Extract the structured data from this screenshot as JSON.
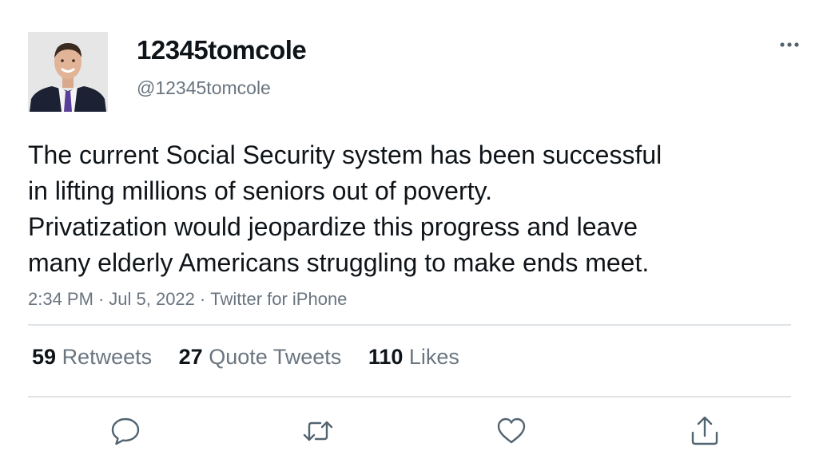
{
  "user": {
    "display_name": "12345tomcole",
    "handle": "@12345tomcole",
    "avatar_icon": "profile-photo"
  },
  "tweet": {
    "text_lines": [
      "The current Social Security system has been successful",
      "in lifting millions of seniors out of poverty.",
      "Privatization would jeopardize this progress and leave",
      "many elderly Americans struggling to make ends meet."
    ],
    "time": "2:34 PM",
    "date": "Jul 5, 2022",
    "source": "Twitter for iPhone",
    "separator": "·"
  },
  "stats": {
    "retweets": {
      "count": "59",
      "label": "Retweets"
    },
    "quotes": {
      "count": "27",
      "label": "Quote Tweets"
    },
    "likes": {
      "count": "110",
      "label": "Likes"
    }
  },
  "actions": {
    "reply_icon": "reply-icon",
    "retweet_icon": "retweet-icon",
    "like_icon": "heart-icon",
    "share_icon": "share-icon"
  },
  "colors": {
    "text": "#0f1419",
    "secondary": "#6a7580",
    "divider": "#dfe3e6",
    "icon": "#536471"
  }
}
